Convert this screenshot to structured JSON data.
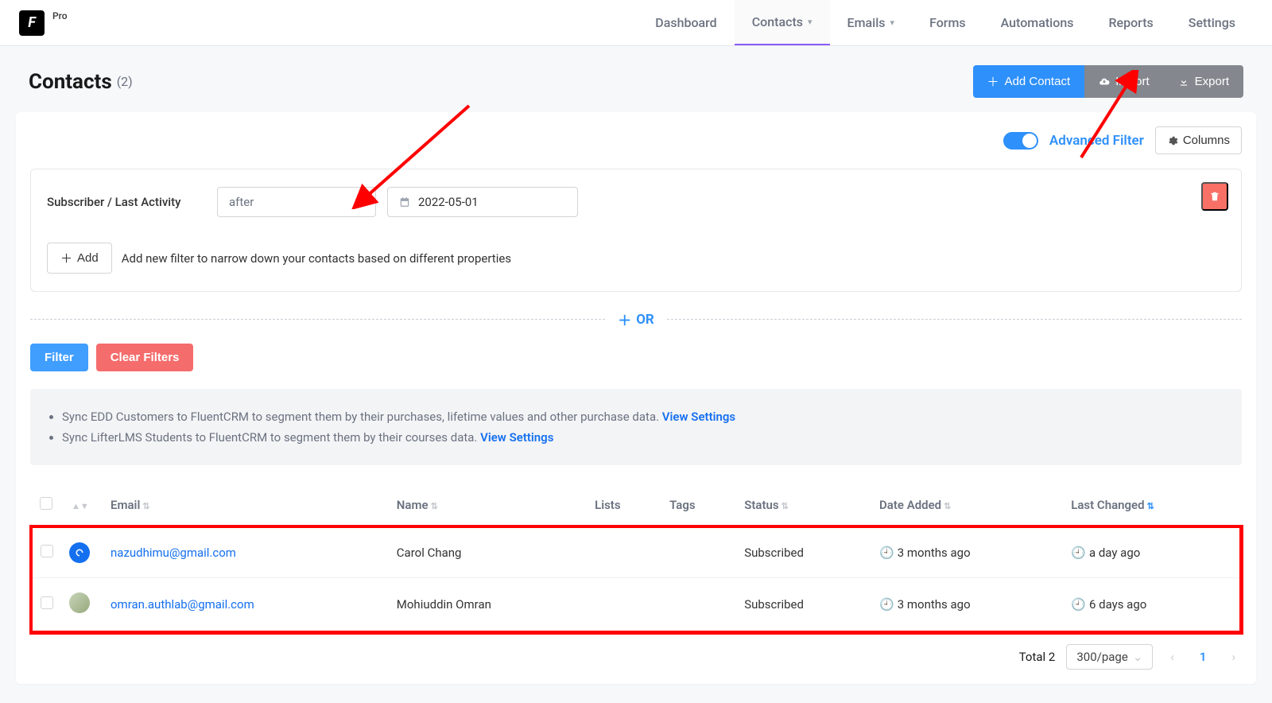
{
  "logo_badge": "Pro",
  "nav": {
    "dashboard": "Dashboard",
    "contacts": "Contacts",
    "emails": "Emails",
    "forms": "Forms",
    "automations": "Automations",
    "reports": "Reports",
    "settings": "Settings"
  },
  "page": {
    "title": "Contacts",
    "count": "(2)"
  },
  "actions": {
    "add": "Add Contact",
    "import": "Import",
    "export": "Export"
  },
  "toolbar": {
    "adv_filter": "Advanced Filter",
    "columns": "Columns"
  },
  "condition": {
    "field": "Subscriber / Last Activity",
    "op": "after",
    "date": "2022-05-01",
    "add_btn": "Add",
    "add_hint": "Add new filter to narrow down your contacts based on different properties"
  },
  "or_label": "OR",
  "filter_actions": {
    "filter": "Filter",
    "clear": "Clear Filters"
  },
  "info": {
    "l1a": "Sync EDD Customers to FluentCRM to segment them by their purchases, lifetime values and other purchase data. ",
    "l1link": "View Settings",
    "l2a": "Sync LifterLMS Students to FluentCRM to segment them by their courses data. ",
    "l2link": "View Settings"
  },
  "columns": {
    "email": "Email",
    "name": "Name",
    "lists": "Lists",
    "tags": "Tags",
    "status": "Status",
    "date_added": "Date Added",
    "last_changed": "Last Changed"
  },
  "rows": [
    {
      "email": "nazudhimu@gmail.com",
      "name": "Carol Chang",
      "status": "Subscribed",
      "date_added": "3 months ago",
      "last_changed": "a day ago",
      "avatar_style": "g"
    },
    {
      "email": "omran.authlab@gmail.com",
      "name": "Mohiuddin Omran",
      "status": "Subscribed",
      "date_added": "3 months ago",
      "last_changed": "6 days ago",
      "avatar_style": "p"
    }
  ],
  "pager": {
    "total_label": "Total 2",
    "per_page": "300/page",
    "current": "1"
  }
}
